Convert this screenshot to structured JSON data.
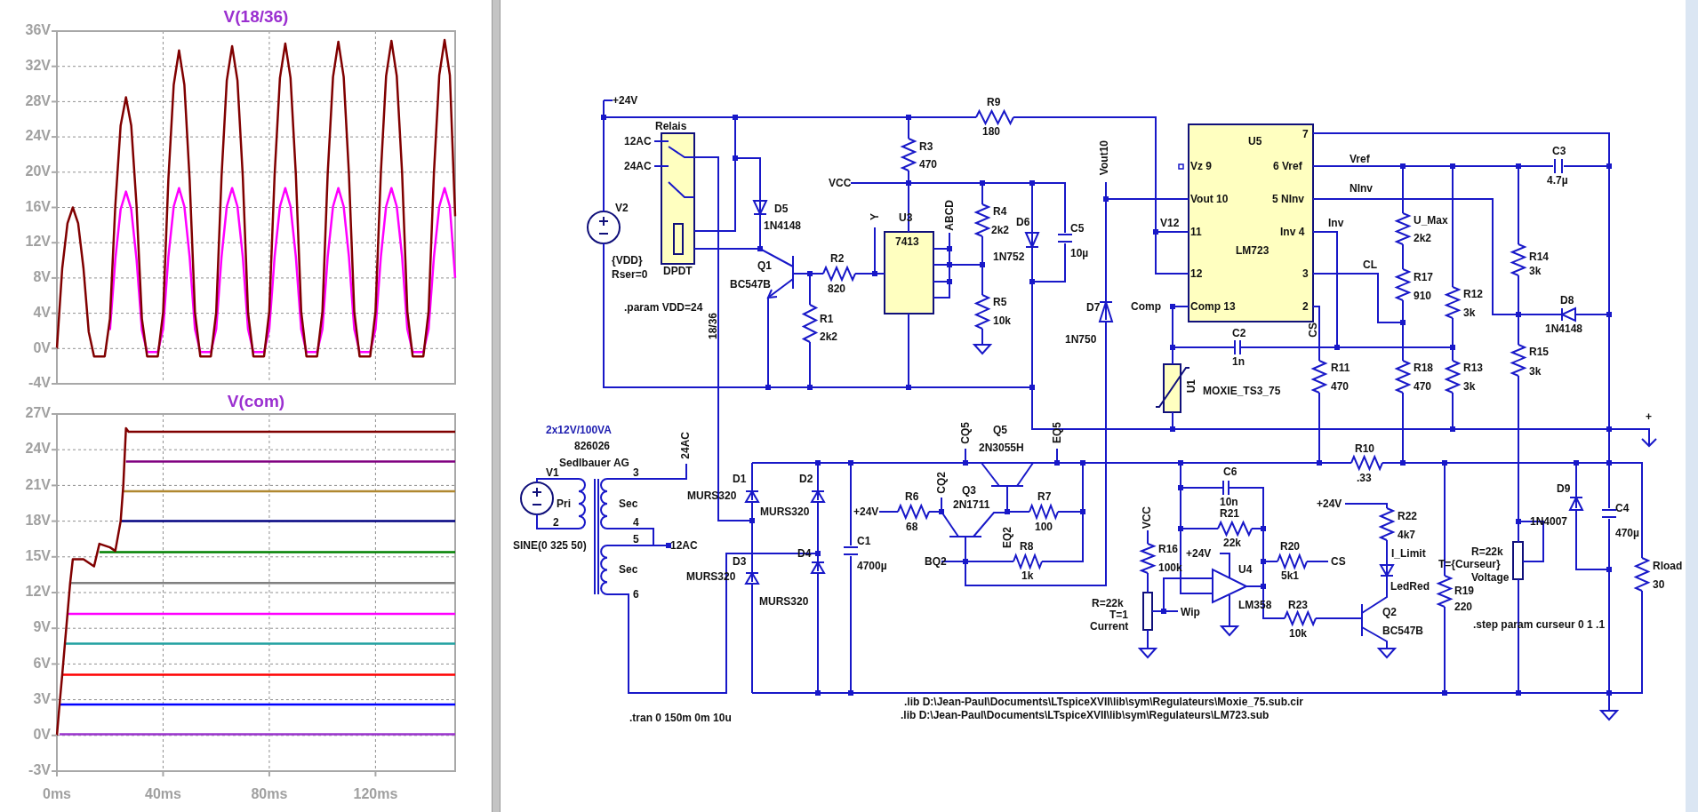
{
  "plot_pane": {
    "charts": [
      {
        "chart_data": {
          "type": "line",
          "title": "V(18/36)",
          "x": [
            0,
            2,
            4,
            6,
            8,
            10,
            12,
            14,
            16,
            18,
            20,
            22,
            24,
            26,
            28,
            30,
            32,
            34,
            36,
            38,
            40,
            42,
            44,
            46,
            48,
            50,
            52,
            54,
            56,
            58,
            60,
            62,
            64,
            66,
            68,
            70,
            72,
            74,
            76,
            78,
            80,
            82,
            84,
            86,
            88,
            90,
            92,
            94,
            96,
            98,
            100,
            102,
            104,
            106,
            108,
            110,
            112,
            114,
            116,
            118,
            120,
            122,
            124,
            126,
            128,
            130,
            132,
            134,
            136,
            138,
            140,
            142,
            144,
            146,
            148,
            150
          ],
          "series": [
            {
              "color": "#ff00ff",
              "values": [
                null,
                null,
                null,
                null,
                null,
                null,
                null,
                null,
                null,
                null,
                2.1,
                10.1,
                15.8,
                17.8,
                15.8,
                10.1,
                2.1,
                -0.4,
                -0.4,
                -0.4,
                2.2,
                10.4,
                16.1,
                18.2,
                16.1,
                10.4,
                2.2,
                -0.4,
                -0.4,
                -0.4,
                2.2,
                10.4,
                16.1,
                18.2,
                16.1,
                10.4,
                2.2,
                -0.4,
                -0.4,
                -0.4,
                2.2,
                10.4,
                16.1,
                18.2,
                16.1,
                10.4,
                2.2,
                -0.4,
                -0.4,
                -0.4,
                2.2,
                10.4,
                16.1,
                18.2,
                16.1,
                10.4,
                2.2,
                -0.4,
                -0.4,
                -0.4,
                2.2,
                10.4,
                16.1,
                18.2,
                16.1,
                10.4,
                2.2,
                -0.4,
                -0.4,
                -0.4,
                2.2,
                10.4,
                16.1,
                18.2,
                16.1,
                8
              ]
            },
            {
              "color": "#800000",
              "values": [
                0,
                9.1,
                14.2,
                16,
                14.2,
                9.1,
                1.9,
                -0.9,
                -0.9,
                -0.9,
                3.4,
                16.2,
                25.3,
                28.5,
                25.3,
                16.2,
                3.4,
                -0.9,
                -0.9,
                -0.9,
                4.1,
                19.2,
                29.9,
                33.8,
                29.9,
                19.2,
                4.1,
                -0.9,
                -0.9,
                -0.9,
                4.1,
                19.5,
                30.4,
                34.3,
                30.4,
                19.5,
                4.1,
                -0.9,
                -0.9,
                -0.9,
                4.2,
                19.7,
                30.7,
                34.6,
                30.7,
                19.7,
                4.2,
                -0.9,
                -0.9,
                -0.9,
                4.2,
                19.8,
                30.8,
                34.8,
                30.8,
                19.8,
                4.2,
                -0.9,
                -0.9,
                -0.9,
                4.2,
                19.9,
                30.9,
                34.9,
                30.9,
                19.9,
                4.2,
                -0.9,
                -0.9,
                -0.9,
                4.2,
                19.9,
                31,
                35,
                31,
                15
              ]
            }
          ],
          "xlim": [
            0,
            150
          ],
          "ylim": [
            -4,
            36
          ],
          "grid": true,
          "yticks": [
            {
              "value": 36,
              "label": "36V"
            },
            {
              "value": 32,
              "label": "32V"
            },
            {
              "value": 28,
              "label": "28V"
            },
            {
              "value": 24,
              "label": "24V"
            },
            {
              "value": 20,
              "label": "20V"
            },
            {
              "value": 16,
              "label": "16V"
            },
            {
              "value": 12,
              "label": "12V"
            },
            {
              "value": 8,
              "label": "8V"
            },
            {
              "value": 4,
              "label": "4V"
            },
            {
              "value": 0,
              "label": "0V"
            },
            {
              "value": -4,
              "label": "-4V"
            }
          ]
        }
      },
      {
        "chart_data": {
          "type": "line",
          "title": "V(com)",
          "x": [
            0,
            1,
            2,
            3,
            4,
            5,
            6,
            10,
            14,
            16,
            20,
            22,
            24,
            25,
            26,
            27,
            150
          ],
          "series": [
            {
              "color": "#9933cc",
              "values": [
                null,
                0.1,
                0.1,
                0.1,
                0.1,
                0.1,
                0.1,
                0.1,
                0.1,
                0.1,
                0.1,
                0.1,
                0.1,
                0.1,
                0.1,
                0.1,
                0.1
              ]
            },
            {
              "color": "#0000ff",
              "values": [
                null,
                2.6,
                2.6,
                2.6,
                2.6,
                2.6,
                2.6,
                2.6,
                2.6,
                2.6,
                2.6,
                2.6,
                2.6,
                2.6,
                2.6,
                2.6,
                2.6
              ]
            },
            {
              "color": "#ff0000",
              "values": [
                null,
                null,
                5.1,
                5.1,
                5.1,
                5.1,
                5.1,
                5.1,
                5.1,
                5.1,
                5.1,
                5.1,
                5.1,
                5.1,
                5.1,
                5.1,
                5.1
              ]
            },
            {
              "color": "#20a0a0",
              "values": [
                null,
                null,
                null,
                7.7,
                7.7,
                7.7,
                7.7,
                7.7,
                7.7,
                7.7,
                7.7,
                7.7,
                7.7,
                7.7,
                7.7,
                7.7,
                7.7
              ]
            },
            {
              "color": "#ff00ff",
              "values": [
                null,
                null,
                null,
                null,
                10.2,
                10.2,
                10.2,
                10.2,
                10.2,
                10.2,
                10.2,
                10.2,
                10.2,
                10.2,
                10.2,
                10.2,
                10.2
              ]
            },
            {
              "color": "#808080",
              "values": [
                null,
                null,
                null,
                null,
                null,
                12.8,
                12.8,
                12.8,
                12.8,
                12.8,
                12.8,
                12.8,
                12.8,
                12.8,
                12.8,
                12.8,
                12.8
              ]
            },
            {
              "color": "#008000",
              "values": [
                null,
                null,
                null,
                null,
                null,
                null,
                null,
                null,
                null,
                15.4,
                15.4,
                15.4,
                15.4,
                15.4,
                15.4,
                15.4,
                15.4
              ]
            },
            {
              "color": "#000080",
              "values": [
                null,
                null,
                null,
                null,
                null,
                null,
                null,
                null,
                null,
                null,
                null,
                null,
                18,
                18,
                18,
                18,
                18
              ]
            },
            {
              "color": "#b08830",
              "values": [
                null,
                null,
                null,
                null,
                null,
                null,
                null,
                null,
                null,
                null,
                null,
                null,
                null,
                20.5,
                20.5,
                20.5,
                20.5
              ]
            },
            {
              "color": "#800080",
              "values": [
                null,
                null,
                null,
                null,
                null,
                null,
                null,
                null,
                null,
                null,
                null,
                null,
                null,
                null,
                23,
                23,
                23
              ]
            },
            {
              "color": "#800000",
              "values": [
                0,
                2.6,
                5.1,
                7.7,
                10.2,
                12.8,
                14.8,
                14.8,
                14.2,
                16.1,
                15.8,
                15.5,
                18,
                21,
                25.8,
                25.5,
                25.5
              ]
            }
          ],
          "xlim": [
            0,
            150
          ],
          "ylim": [
            -3,
            27
          ],
          "grid": true,
          "xticks": [
            {
              "value": 0,
              "label": "0ms"
            },
            {
              "value": 40,
              "label": "40ms"
            },
            {
              "value": 80,
              "label": "80ms"
            },
            {
              "value": 120,
              "label": "120ms"
            }
          ],
          "yticks": [
            {
              "value": 27,
              "label": "27V"
            },
            {
              "value": 24,
              "label": "24V"
            },
            {
              "value": 21,
              "label": "21V"
            },
            {
              "value": 18,
              "label": "18V"
            },
            {
              "value": 15,
              "label": "15V"
            },
            {
              "value": 12,
              "label": "12V"
            },
            {
              "value": 9,
              "label": "9V"
            },
            {
              "value": 6,
              "label": "6V"
            },
            {
              "value": 3,
              "label": "3V"
            },
            {
              "value": 0,
              "label": "0V"
            },
            {
              "value": -3,
              "label": "-3V"
            }
          ]
        }
      }
    ]
  },
  "schematic": {
    "labels": [
      {
        "text": "+24V",
        "kind": "text"
      },
      {
        "text": "R9",
        "kind": "text"
      },
      {
        "text": "180",
        "kind": "text"
      },
      {
        "text": "Relais",
        "kind": "text"
      },
      {
        "text": "12AC",
        "kind": "text"
      },
      {
        "text": "24AC",
        "kind": "text"
      },
      {
        "text": "R3",
        "kind": "text"
      },
      {
        "text": "470",
        "kind": "text"
      },
      {
        "text": "VCC",
        "kind": "text"
      },
      {
        "text": "Y",
        "kind": "vertical"
      },
      {
        "text": "U3",
        "kind": "text"
      },
      {
        "text": "ABCD",
        "kind": "vertical"
      },
      {
        "text": "V2",
        "kind": "text"
      },
      {
        "text": "D5",
        "kind": "text"
      },
      {
        "text": "1N4148",
        "kind": "text"
      },
      {
        "text": "7413",
        "kind": "text"
      },
      {
        "text": "R4",
        "kind": "text"
      },
      {
        "text": "2k2",
        "kind": "text"
      },
      {
        "text": "D6",
        "kind": "text"
      },
      {
        "text": "1N752",
        "kind": "text"
      },
      {
        "text": "C5",
        "kind": "text"
      },
      {
        "text": "10µ",
        "kind": "text"
      },
      {
        "text": "Vout10",
        "kind": "vertical"
      },
      {
        "text": "{VDD}",
        "kind": "text"
      },
      {
        "text": "Rser=0",
        "kind": "text"
      },
      {
        "text": "DPDT",
        "kind": "text"
      },
      {
        "text": "Q1",
        "kind": "text"
      },
      {
        "text": "BC547B",
        "kind": "text"
      },
      {
        "text": "R2",
        "kind": "text"
      },
      {
        "text": "820",
        "kind": "text"
      },
      {
        "text": ".param VDD=24",
        "kind": "text"
      },
      {
        "text": "R5",
        "kind": "text"
      },
      {
        "text": "10k",
        "kind": "text"
      },
      {
        "text": "D7",
        "kind": "text"
      },
      {
        "text": "1N750",
        "kind": "text"
      },
      {
        "text": "R1",
        "kind": "text"
      },
      {
        "text": "2k2",
        "kind": "text"
      },
      {
        "text": "18/36",
        "kind": "vertical"
      },
      {
        "text": "U5",
        "kind": "text"
      },
      {
        "text": "7",
        "kind": "text"
      },
      {
        "text": "Vz 9",
        "kind": "text"
      },
      {
        "text": "6 Vref",
        "kind": "text"
      },
      {
        "text": "Vref",
        "kind": "text"
      },
      {
        "text": "C3",
        "kind": "text"
      },
      {
        "text": "4.7µ",
        "kind": "text"
      },
      {
        "text": "Vout 10",
        "kind": "text"
      },
      {
        "text": "5 NInv",
        "kind": "text"
      },
      {
        "text": "NInv",
        "kind": "text"
      },
      {
        "text": "V12",
        "kind": "text"
      },
      {
        "text": "11",
        "kind": "text"
      },
      {
        "text": "Inv 4",
        "kind": "text"
      },
      {
        "text": "Inv",
        "kind": "text"
      },
      {
        "text": "U_Max",
        "kind": "text"
      },
      {
        "text": "2k2",
        "kind": "text"
      },
      {
        "text": "LM723",
        "kind": "text"
      },
      {
        "text": "R14",
        "kind": "text"
      },
      {
        "text": "12",
        "kind": "text"
      },
      {
        "text": "3",
        "kind": "text"
      },
      {
        "text": "CL",
        "kind": "text"
      },
      {
        "text": "3k",
        "kind": "text"
      },
      {
        "text": "R17",
        "kind": "text"
      },
      {
        "text": "910",
        "kind": "text"
      },
      {
        "text": "R12",
        "kind": "text"
      },
      {
        "text": "3k",
        "kind": "text"
      },
      {
        "text": "D8",
        "kind": "text"
      },
      {
        "text": "1N4148",
        "kind": "text"
      },
      {
        "text": "Comp",
        "kind": "text"
      },
      {
        "text": "Comp 13",
        "kind": "text"
      },
      {
        "text": "2",
        "kind": "text"
      },
      {
        "text": "C2",
        "kind": "text"
      },
      {
        "text": "1n",
        "kind": "text"
      },
      {
        "text": "CS",
        "kind": "vertical"
      },
      {
        "text": "R15",
        "kind": "text"
      },
      {
        "text": "3k",
        "kind": "text"
      },
      {
        "text": "R11",
        "kind": "text"
      },
      {
        "text": "470",
        "kind": "text"
      },
      {
        "text": "R18",
        "kind": "text"
      },
      {
        "text": "470",
        "kind": "text"
      },
      {
        "text": "R13",
        "kind": "text"
      },
      {
        "text": "3k",
        "kind": "text"
      },
      {
        "text": "U1",
        "kind": "vertical"
      },
      {
        "text": "MOXIE_TS3_75",
        "kind": "text"
      },
      {
        "text": "+",
        "kind": "text"
      },
      {
        "text": "2x12V/100VA",
        "kind": "note"
      },
      {
        "text": "826026",
        "kind": "text"
      },
      {
        "text": "Sedlbauer AG",
        "kind": "text"
      },
      {
        "text": "24AC",
        "kind": "vertical"
      },
      {
        "text": "V1",
        "kind": "text"
      },
      {
        "text": "3",
        "kind": "text"
      },
      {
        "text": "Pri",
        "kind": "text"
      },
      {
        "text": "Sec",
        "kind": "text"
      },
      {
        "text": "2",
        "kind": "text"
      },
      {
        "text": "4",
        "kind": "text"
      },
      {
        "text": "SINE(0 325 50)",
        "kind": "text"
      },
      {
        "text": "5",
        "kind": "text"
      },
      {
        "text": "12AC",
        "kind": "text"
      },
      {
        "text": "Sec",
        "kind": "text"
      },
      {
        "text": "6",
        "kind": "text"
      },
      {
        "text": "D1",
        "kind": "text"
      },
      {
        "text": "MURS320",
        "kind": "text"
      },
      {
        "text": "D2",
        "kind": "text"
      },
      {
        "text": "MURS320",
        "kind": "text"
      },
      {
        "text": "+24V",
        "kind": "text"
      },
      {
        "text": "D3",
        "kind": "text"
      },
      {
        "text": "MURS320",
        "kind": "text"
      },
      {
        "text": "D4",
        "kind": "text"
      },
      {
        "text": "MURS320",
        "kind": "text"
      },
      {
        "text": "C1",
        "kind": "text"
      },
      {
        "text": "4700µ",
        "kind": "text"
      },
      {
        "text": "R6",
        "kind": "text"
      },
      {
        "text": "68",
        "kind": "text"
      },
      {
        "text": "CQ5",
        "kind": "vertical"
      },
      {
        "text": "Q5",
        "kind": "text"
      },
      {
        "text": "2N3055H",
        "kind": "text"
      },
      {
        "text": "EQ5",
        "kind": "vertical"
      },
      {
        "text": "CQ2",
        "kind": "vertical"
      },
      {
        "text": "Q3",
        "kind": "text"
      },
      {
        "text": "2N1711",
        "kind": "text"
      },
      {
        "text": "R7",
        "kind": "text"
      },
      {
        "text": "100",
        "kind": "text"
      },
      {
        "text": "EQ2",
        "kind": "vertical"
      },
      {
        "text": "R8",
        "kind": "text"
      },
      {
        "text": "1k",
        "kind": "text"
      },
      {
        "text": "BQ2",
        "kind": "text"
      },
      {
        "text": ".tran 0 150m 0m 10u",
        "kind": "text"
      },
      {
        "text": ".lib D:\\Jean-Paul\\Documents\\LTspiceXVII\\lib\\sym\\Regulateurs\\Moxie_75.sub.cir",
        "kind": "text"
      },
      {
        "text": ".lib D:\\Jean-Paul\\Documents\\LTspiceXVII\\lib\\sym\\Regulateurs\\LM723.sub",
        "kind": "text"
      },
      {
        "text": "R10",
        "kind": "text"
      },
      {
        "text": ".33",
        "kind": "text"
      },
      {
        "text": "C6",
        "kind": "text"
      },
      {
        "text": "10n",
        "kind": "text"
      },
      {
        "text": "R21",
        "kind": "text"
      },
      {
        "text": "22k",
        "kind": "text"
      },
      {
        "text": "VCC",
        "kind": "vertical"
      },
      {
        "text": "+24V",
        "kind": "text"
      },
      {
        "text": "R22",
        "kind": "text"
      },
      {
        "text": "4k7",
        "kind": "text"
      },
      {
        "text": "D9",
        "kind": "text"
      },
      {
        "text": "1N4007",
        "kind": "text"
      },
      {
        "text": "C4",
        "kind": "text"
      },
      {
        "text": "470µ",
        "kind": "text"
      },
      {
        "text": "R16",
        "kind": "text"
      },
      {
        "text": "100k",
        "kind": "text"
      },
      {
        "text": "+24V",
        "kind": "text"
      },
      {
        "text": "U4",
        "kind": "text"
      },
      {
        "text": "R20",
        "kind": "text"
      },
      {
        "text": "5k1",
        "kind": "text"
      },
      {
        "text": "CS",
        "kind": "text"
      },
      {
        "text": "I_Limit",
        "kind": "text"
      },
      {
        "text": "R=22k",
        "kind": "text"
      },
      {
        "text": "T={Curseur}",
        "kind": "text"
      },
      {
        "text": "Voltage",
        "kind": "text"
      },
      {
        "text": "Rload",
        "kind": "text"
      },
      {
        "text": "LedRed",
        "kind": "text"
      },
      {
        "text": "R19",
        "kind": "text"
      },
      {
        "text": "30",
        "kind": "text"
      },
      {
        "text": "R=22k",
        "kind": "text"
      },
      {
        "text": "LM358",
        "kind": "text"
      },
      {
        "text": "R23",
        "kind": "text"
      },
      {
        "text": "220",
        "kind": "text"
      },
      {
        "text": "T=1",
        "kind": "text"
      },
      {
        "text": "Wip",
        "kind": "text"
      },
      {
        "text": "Q2",
        "kind": "text"
      },
      {
        "text": "Current",
        "kind": "text"
      },
      {
        "text": "10k",
        "kind": "text"
      },
      {
        "text": "BC547B",
        "kind": "text"
      },
      {
        "text": ".step param curseur 0 1 .1",
        "kind": "text"
      }
    ]
  }
}
